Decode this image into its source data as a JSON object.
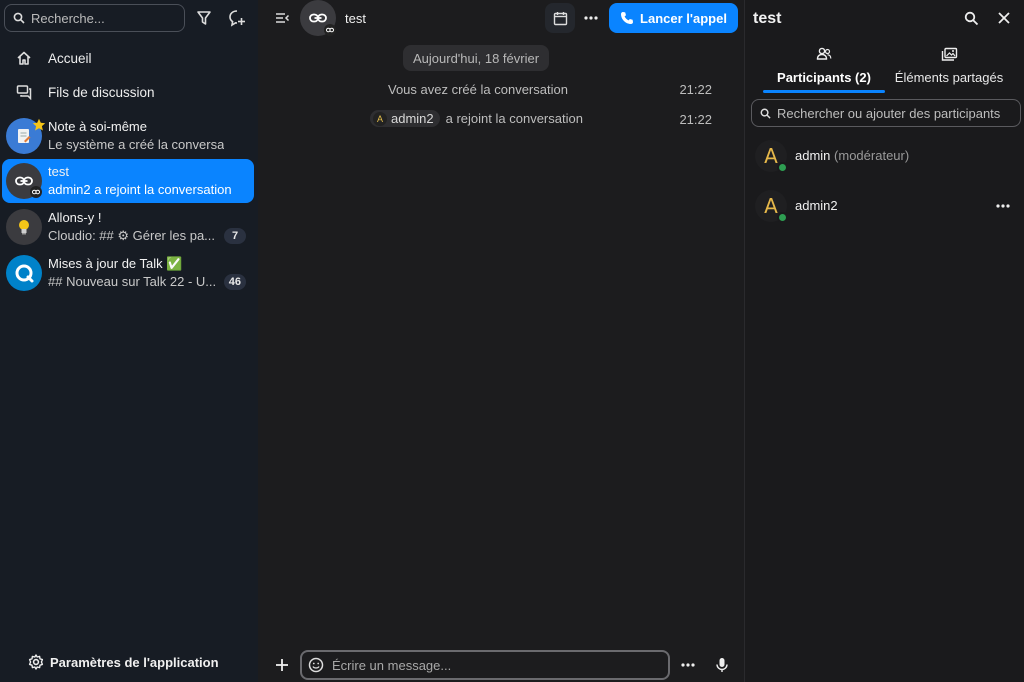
{
  "sidebar": {
    "search_placeholder": "Recherche...",
    "nav": [
      {
        "label": "Accueil"
      },
      {
        "label": "Fils de discussion"
      }
    ],
    "conversations": [
      {
        "name": "Note à soi-même",
        "sub": "Le système a créé la conversation",
        "badge": ""
      },
      {
        "name": "test",
        "sub": "admin2 a rejoint la conversation",
        "badge": ""
      },
      {
        "name": "Allons-y !",
        "sub": "Cloudio: ## ⚙ Gérer les pa...",
        "badge": "7"
      },
      {
        "name": "Mises à jour de Talk ✅",
        "sub": "## Nouveau sur Talk 22 - U...",
        "badge": "46"
      }
    ],
    "app_settings": "Paramètres de l'application"
  },
  "main": {
    "conversation_name": "test",
    "call_button": "Lancer l'appel",
    "date_separator": "Aujourd'hui, 18 février",
    "messages": [
      {
        "text": "Vous avez créé la conversation",
        "time": "21:22"
      },
      {
        "mention": "admin2",
        "text": "a rejoint la conversation",
        "time": "21:22"
      }
    ],
    "composer_placeholder": "Écrire un message..."
  },
  "right_panel": {
    "title": "test",
    "tabs": [
      {
        "label": "Participants (2)",
        "active": true
      },
      {
        "label": "Éléments partagés",
        "active": false
      }
    ],
    "search_placeholder": "Rechercher ou ajouter des participants",
    "participants": [
      {
        "initial": "A",
        "name": "admin",
        "role": "(modérateur)"
      },
      {
        "initial": "A",
        "name": "admin2",
        "role": ""
      }
    ]
  },
  "colors": {
    "accent": "#0a84ff",
    "sidebar_bg": "#171c24",
    "main_bg": "#1c1c1e",
    "online": "#2e9e52",
    "avatar_initial": "#e6b84a"
  }
}
